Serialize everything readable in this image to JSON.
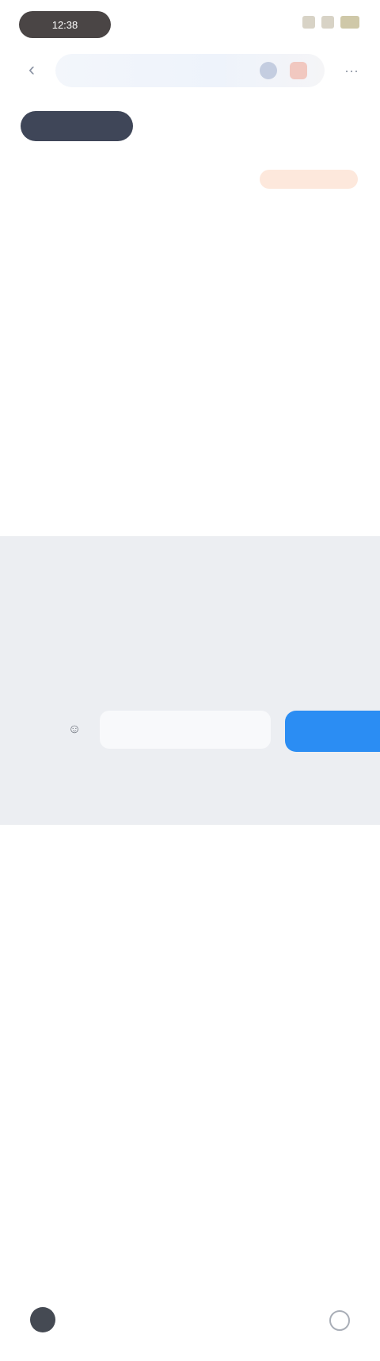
{
  "status": {
    "time": "12:38"
  },
  "search": {
    "value": "",
    "placeholder": ""
  },
  "tabs": [
    {
      "label": ""
    },
    {
      "label": ""
    },
    {
      "label": ""
    }
  ],
  "sort": {
    "label": "",
    "action": ""
  },
  "results": [
    {
      "title": "",
      "sub": "",
      "price": ""
    },
    {
      "title": "",
      "sub": "",
      "price": ""
    },
    {
      "title": "",
      "sub": "",
      "price": ""
    },
    {
      "title": "",
      "sub": "",
      "price": ""
    },
    {
      "title": "",
      "sub": "",
      "price": ""
    },
    {
      "title": "",
      "sub": "",
      "price": ""
    }
  ],
  "suggestion": "",
  "keyboard": {
    "row1": [
      "",
      "",
      "",
      "",
      "",
      "",
      "",
      "",
      "",
      ""
    ],
    "row2": [
      "",
      "",
      "",
      "",
      "",
      "",
      "",
      "",
      ""
    ],
    "row3": [
      "",
      "",
      "",
      "",
      "",
      "",
      "",
      "",
      ""
    ],
    "symbols": "",
    "go": ""
  },
  "colors": {
    "accent": "#2b8df3",
    "activeTab": "#3f4658",
    "sortAction": "#f08a55"
  }
}
